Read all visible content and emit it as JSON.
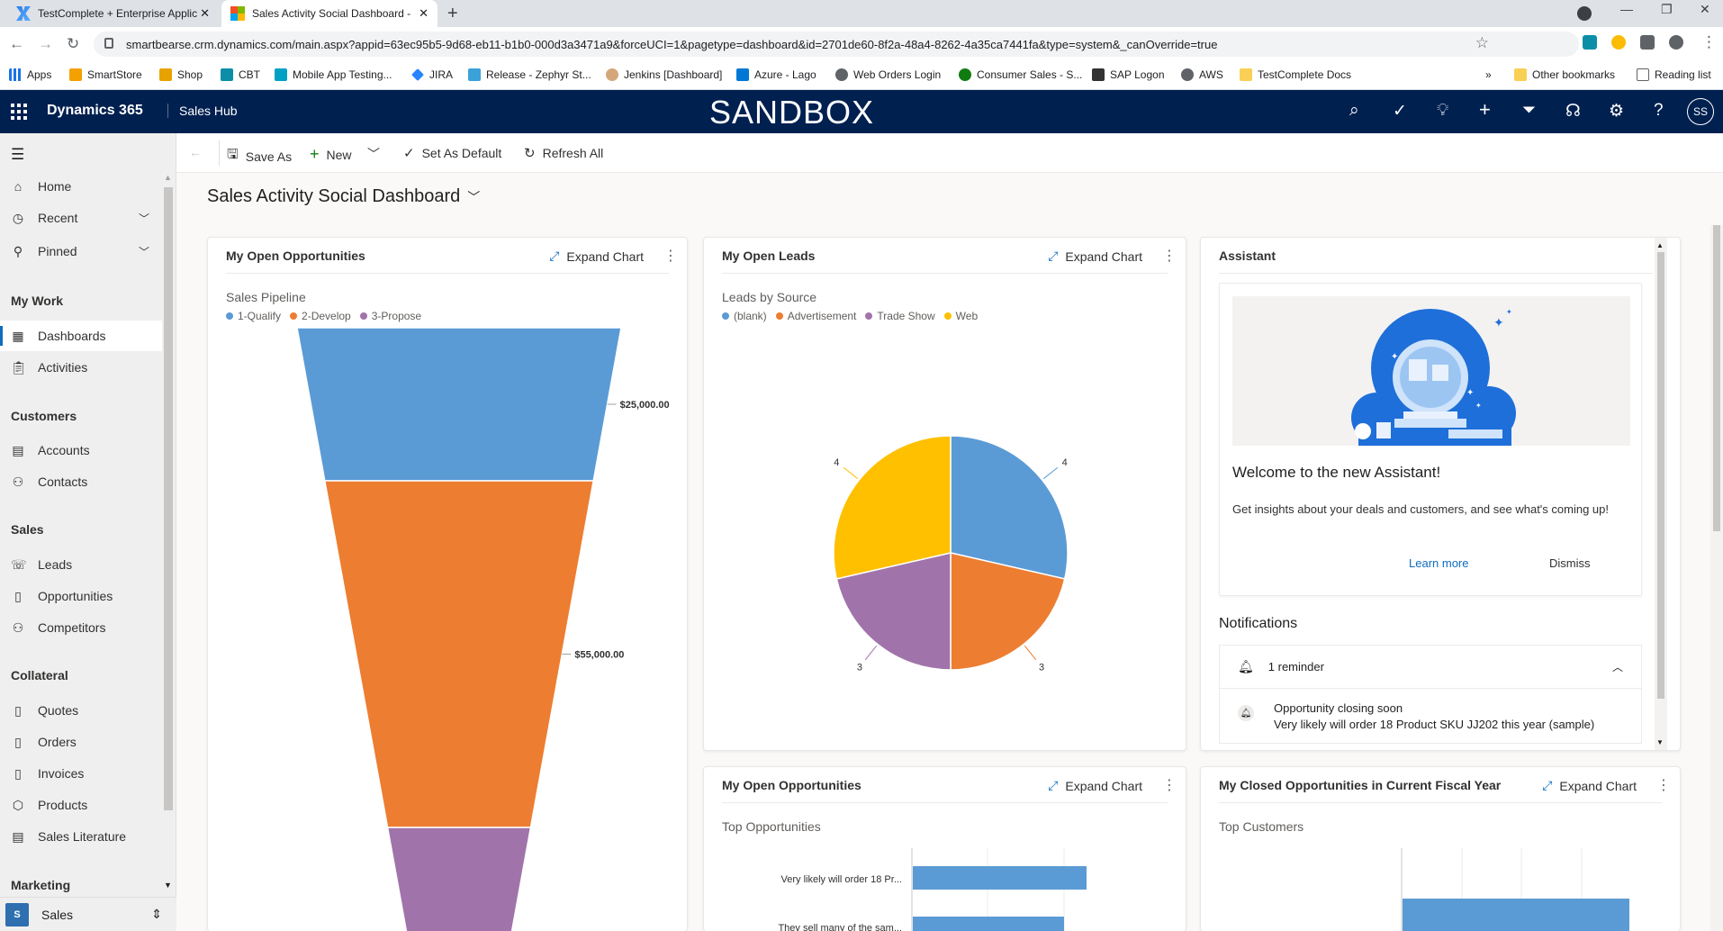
{
  "browser": {
    "tabs": [
      {
        "title": "TestComplete + Enterprise Applic"
      },
      {
        "title": "Sales Activity Social Dashboard -"
      }
    ],
    "url": "smartbearse.crm.dynamics.com/main.aspx?appid=63ec95b5-9d68-eb11-b1b0-000d3a3471a9&forceUCI=1&pagetype=dashboard&id=2701de60-8f2a-48a4-8262-4a35ca7441fa&type=system&_canOverride=true",
    "bookmarks": [
      "Apps",
      "SmartStore",
      "Shop",
      "CBT",
      "Mobile App Testing...",
      "JIRA",
      "Release - Zephyr St...",
      "Jenkins [Dashboard]",
      "Azure - Lago",
      "Web Orders Login",
      "Consumer Sales - S...",
      "SAP Logon",
      "AWS",
      "TestComplete Docs"
    ],
    "other_bookmarks": "Other bookmarks",
    "reading_list": "Reading list",
    "overflow": "»"
  },
  "header": {
    "app": "Dynamics 365",
    "hub": "Sales Hub",
    "env": "SANDBOX",
    "avatar": "SS",
    "icons": [
      "search-icon",
      "task-check-icon",
      "lightbulb-icon",
      "plus-icon",
      "filter-icon",
      "assistant-icon",
      "settings-icon",
      "help-icon"
    ]
  },
  "sidebar": {
    "items_top": [
      {
        "label": "Home",
        "icon": "home-icon"
      },
      {
        "label": "Recent",
        "icon": "clock-icon"
      },
      {
        "label": "Pinned",
        "icon": "pin-icon"
      }
    ],
    "groups": [
      {
        "title": "My Work",
        "items": [
          "Dashboards",
          "Activities"
        ]
      },
      {
        "title": "Customers",
        "items": [
          "Accounts",
          "Contacts"
        ]
      },
      {
        "title": "Sales",
        "items": [
          "Leads",
          "Opportunities",
          "Competitors"
        ]
      },
      {
        "title": "Collateral",
        "items": [
          "Quotes",
          "Orders",
          "Invoices",
          "Products",
          "Sales Literature"
        ]
      },
      {
        "title": "Marketing",
        "items": []
      }
    ],
    "area": {
      "badge": "S",
      "label": "Sales"
    }
  },
  "commands": {
    "save_as": "Save As",
    "new": "New",
    "set_default": "Set As Default",
    "refresh": "Refresh All"
  },
  "page": {
    "title": "Sales Activity Social Dashboard"
  },
  "cards": {
    "opp": {
      "title": "My Open Opportunities",
      "expand": "Expand Chart",
      "chart_name": "Sales Pipeline"
    },
    "leads": {
      "title": "My Open Leads",
      "expand": "Expand Chart",
      "chart_name": "Leads by Source"
    },
    "opp2": {
      "title": "My Open Opportunities",
      "expand": "Expand Chart",
      "chart_name": "Top Opportunities"
    },
    "closed": {
      "title": "My Closed Opportunities in Current Fiscal Year",
      "expand": "Expand Chart",
      "chart_name": "Top Customers"
    }
  },
  "assistant": {
    "title": "Assistant",
    "welcome": "Welcome to the new Assistant!",
    "desc": "Get insights about your deals and customers, and see what's coming up!",
    "learn_more": "Learn more",
    "dismiss": "Dismiss",
    "notifications_title": "Notifications",
    "reminder": "1 reminder",
    "notif_title": "Opportunity closing soon",
    "notif_text": "Very likely will order 18 Product SKU JJ202 this year (sample)"
  },
  "colors": {
    "blue": "#5b9bd5",
    "orange": "#ed7d31",
    "purple": "#a074aa",
    "yellow": "#ffc000",
    "brand": "#002050",
    "accent": "#0f6cbd"
  },
  "chart_data": [
    {
      "type": "funnel",
      "title": "Sales Pipeline",
      "series": [
        {
          "name": "1-Qualify",
          "value": 25000,
          "label": "$25,000.00"
        },
        {
          "name": "2-Develop",
          "value": 55000,
          "label": "$55,000.00"
        },
        {
          "name": "3-Propose",
          "value": null,
          "label": ""
        }
      ]
    },
    {
      "type": "pie",
      "title": "Leads by Source",
      "series": [
        {
          "name": "(blank)",
          "value": 4
        },
        {
          "name": "Advertisement",
          "value": 3
        },
        {
          "name": "Trade Show",
          "value": 3
        },
        {
          "name": "Web",
          "value": 4
        }
      ]
    },
    {
      "type": "bar",
      "title": "Top Opportunities",
      "categories": [
        "Very likely will order 18 Pr...",
        "They sell many of the sam..."
      ],
      "values": [
        null,
        null
      ]
    },
    {
      "type": "bar",
      "title": "Top Customers",
      "categories": [
        ""
      ],
      "values": [
        null
      ]
    }
  ]
}
